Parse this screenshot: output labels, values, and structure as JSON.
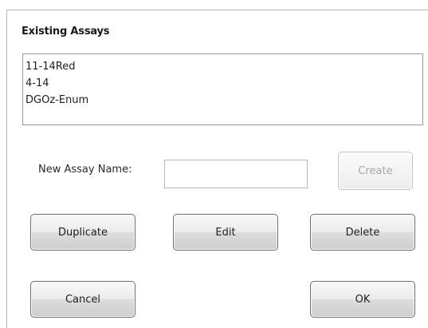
{
  "existing_assays": {
    "title": "Existing Assays",
    "items": [
      {
        "label": "11-14Red"
      },
      {
        "label": "4-14"
      },
      {
        "label": "DGOz-Enum"
      }
    ]
  },
  "new_assay": {
    "label": "New Assay Name:",
    "value": "",
    "placeholder": ""
  },
  "buttons": {
    "create": "Create",
    "duplicate": "Duplicate",
    "edit": "Edit",
    "delete": "Delete",
    "cancel": "Cancel",
    "ok": "OK"
  },
  "states": {
    "create_enabled": false
  },
  "colors": {
    "button_border": "#6e6e6e",
    "disabled_text": "#a8a8a8",
    "list_border": "#9a9a9a"
  }
}
